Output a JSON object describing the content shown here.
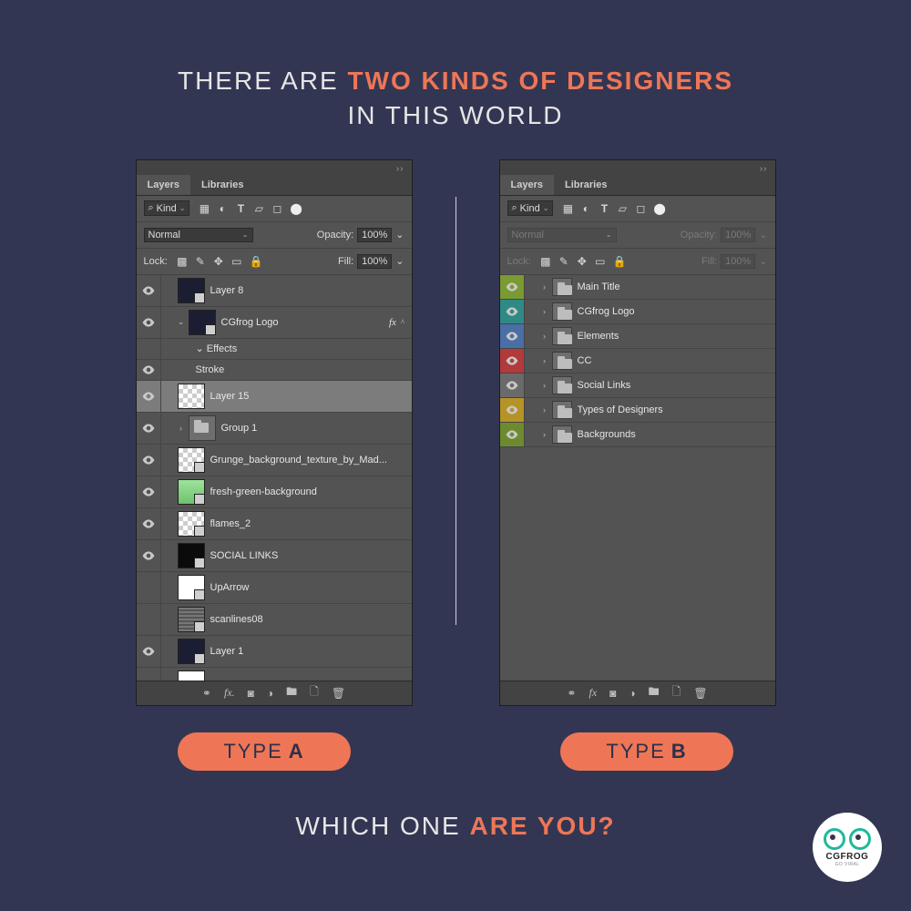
{
  "title": {
    "pre": "THERE ARE ",
    "accent": "TWO KINDS OF DESIGNERS",
    "post": "IN THIS WORLD"
  },
  "badges": {
    "a_pre": "TYPE ",
    "a_bold": "A",
    "b_pre": "TYPE ",
    "b_bold": "B"
  },
  "question": {
    "pre": "WHICH ONE ",
    "accent": "ARE YOU?"
  },
  "brand": {
    "name": "CGFROG",
    "sub": "GO VIRAL"
  },
  "panelA": {
    "tabs": {
      "active": "Layers",
      "other": "Libraries"
    },
    "filter": {
      "label": "Kind"
    },
    "blend": {
      "mode": "Normal",
      "opacity_label": "Opacity:",
      "opacity": "100%"
    },
    "lock": {
      "label": "Lock:",
      "fill_label": "Fill:",
      "fill": "100%"
    },
    "layers": [
      {
        "name": "Layer 8",
        "thumb": "dark",
        "corner": true
      },
      {
        "name": "CGfrog Logo",
        "thumb": "dark",
        "corner": true,
        "fx": true,
        "expanded": true,
        "children": [
          {
            "name": "Effects"
          },
          {
            "name": "Stroke",
            "eye": true
          }
        ]
      },
      {
        "name": "Layer 15",
        "thumb": "checker",
        "selected": true
      },
      {
        "name": "Group 1",
        "thumb": "folder",
        "arrow": true
      },
      {
        "name": "Grunge_background_texture_by_Mad...",
        "thumb": "checker",
        "corner": true
      },
      {
        "name": "fresh-green-background",
        "thumb": "green",
        "corner": true
      },
      {
        "name": "flames_2",
        "thumb": "checker",
        "corner": true
      },
      {
        "name": "SOCIAL LINKS",
        "thumb": "black",
        "corner": true
      },
      {
        "name": "UpArrow",
        "thumb": "white",
        "corner": true,
        "noeye": true
      },
      {
        "name": "scanlines08",
        "thumb": "lines",
        "corner": true,
        "noeye": true
      },
      {
        "name": "Layer 1",
        "thumb": "dark",
        "corner": true
      },
      {
        "name": "",
        "thumb": "white",
        "noeye": true
      }
    ]
  },
  "panelB": {
    "tabs": {
      "active": "Layers",
      "other": "Libraries"
    },
    "filter": {
      "label": "Kind"
    },
    "blend": {
      "mode": "Normal",
      "opacity_label": "Opacity:",
      "opacity": "100%"
    },
    "lock": {
      "label": "Lock:",
      "fill_label": "Fill:",
      "fill": "100%"
    },
    "layers": [
      {
        "name": "Main Title",
        "color": "green"
      },
      {
        "name": "CGfrog Logo",
        "color": "teal"
      },
      {
        "name": "Elements",
        "color": "blue"
      },
      {
        "name": "CC",
        "color": "red"
      },
      {
        "name": "Social Links",
        "color": "gray"
      },
      {
        "name": "Types of Designers",
        "color": "yellow"
      },
      {
        "name": "Backgrounds",
        "color": "olive"
      }
    ]
  }
}
